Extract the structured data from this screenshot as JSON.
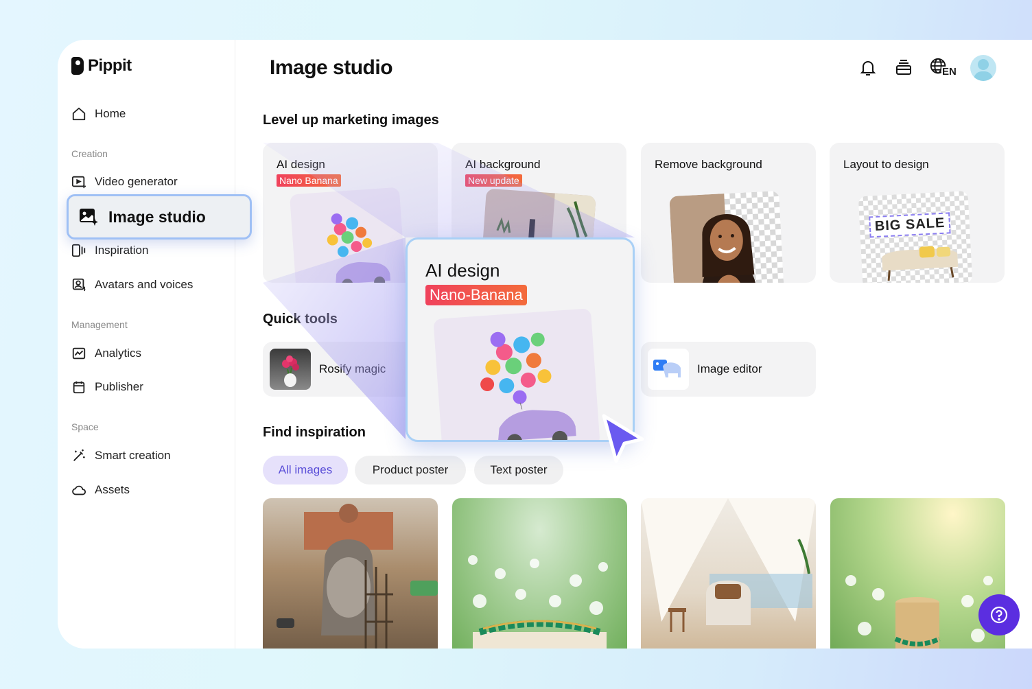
{
  "app": {
    "brand": "Pippit",
    "page_title": "Image studio"
  },
  "sidebar": {
    "home": "Home",
    "sections": {
      "creation": "Creation",
      "management": "Management",
      "space": "Space"
    },
    "items": {
      "video_generator": "Video generator",
      "image_studio": "Image studio",
      "inspiration": "Inspiration",
      "avatars_voices": "Avatars and voices",
      "analytics": "Analytics",
      "publisher": "Publisher",
      "smart_creation": "Smart creation",
      "assets": "Assets"
    }
  },
  "header": {
    "language": "EN"
  },
  "marketing": {
    "title": "Level up marketing images",
    "cards": [
      {
        "title": "AI design",
        "tag": "Nano Banana"
      },
      {
        "title": "AI background",
        "tag": "New update"
      },
      {
        "title": "Remove background"
      },
      {
        "title": "Layout to design",
        "sale_text": "BIG SALE"
      }
    ]
  },
  "quick_tools": {
    "title": "Quick tools",
    "items": [
      {
        "label": "Rosify magic"
      },
      {
        "label": "Image editor"
      }
    ]
  },
  "inspiration": {
    "title": "Find inspiration",
    "chips": [
      "All images",
      "Product poster",
      "Text poster"
    ],
    "active_chip": "All images"
  },
  "zoom_card": {
    "title": "AI design",
    "tag": "Nano-Banana"
  },
  "colors": {
    "accent": "#5b2ee0",
    "active_chip_text": "#5b4fd8",
    "tag_gradient_start": "#f0425c",
    "tag_gradient_end": "#f36b3b",
    "highlight_border": "#9fc0f5"
  }
}
